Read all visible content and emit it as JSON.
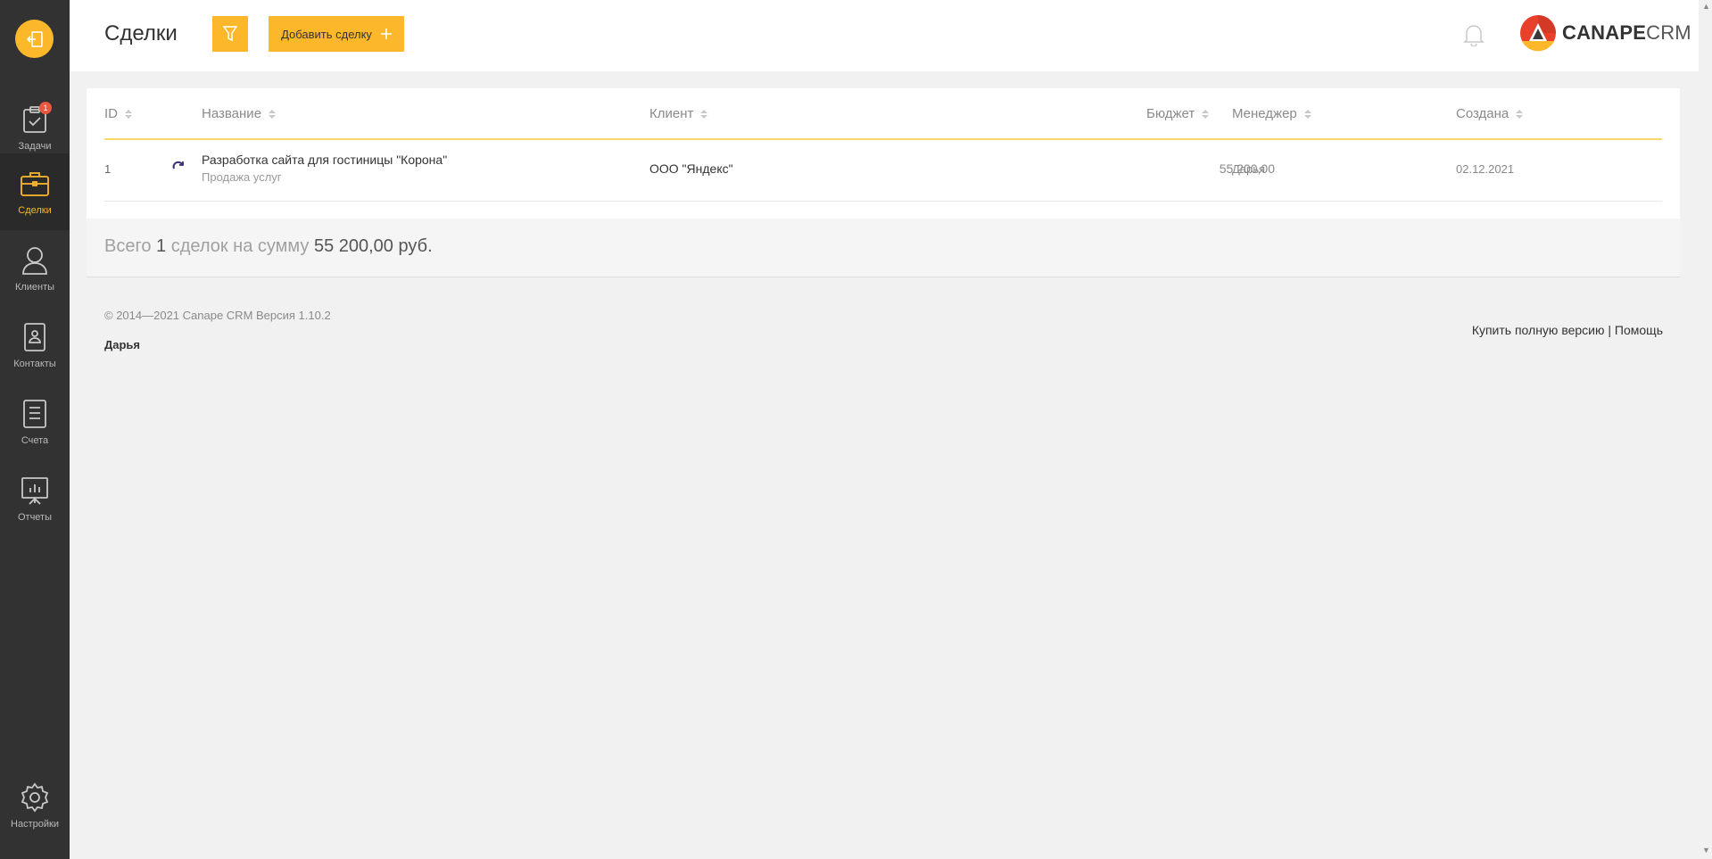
{
  "sidebar": {
    "items": [
      {
        "label": "Задачи",
        "icon": "tasks-icon",
        "badge": "1"
      },
      {
        "label": "Сделки",
        "icon": "briefcase-icon",
        "active": true
      },
      {
        "label": "Клиенты",
        "icon": "user-icon"
      },
      {
        "label": "Контакты",
        "icon": "contact-book-icon"
      },
      {
        "label": "Счета",
        "icon": "invoice-icon"
      },
      {
        "label": "Отчеты",
        "icon": "report-icon"
      }
    ],
    "settings": {
      "label": "Настройки",
      "icon": "gear-icon"
    }
  },
  "header": {
    "title": "Сделки",
    "add_button": "Добавить сделку",
    "logo_bold": "CANAPE",
    "logo_light": "CRM"
  },
  "table": {
    "columns": {
      "id": "ID",
      "name": "Название",
      "client": "Клиент",
      "budget": "Бюджет",
      "manager": "Менеджер",
      "created": "Создана"
    },
    "rows": [
      {
        "id": "1",
        "name": "Разработка сайта для гостиницы \"Корона\"",
        "subtitle": "Продажа услуг",
        "client": "ООО \"Яндекс\"",
        "budget": "55 200,00",
        "manager": "Дарья",
        "created": "02.12.2021"
      }
    ]
  },
  "summary": {
    "prefix": "Всего",
    "count": "1",
    "middle": "сделок на сумму",
    "amount": "55 200,00",
    "suffix": "руб."
  },
  "footer": {
    "copyright": "© 2014—2021 Canape CRM Версия 1.10.2",
    "user": "Дарья",
    "buy_link": "Купить полную версию",
    "separator": "|",
    "help_link": "Помощь"
  },
  "colors": {
    "accent": "#fcb82a",
    "sidebar": "#323232",
    "badge": "#e9573f"
  }
}
